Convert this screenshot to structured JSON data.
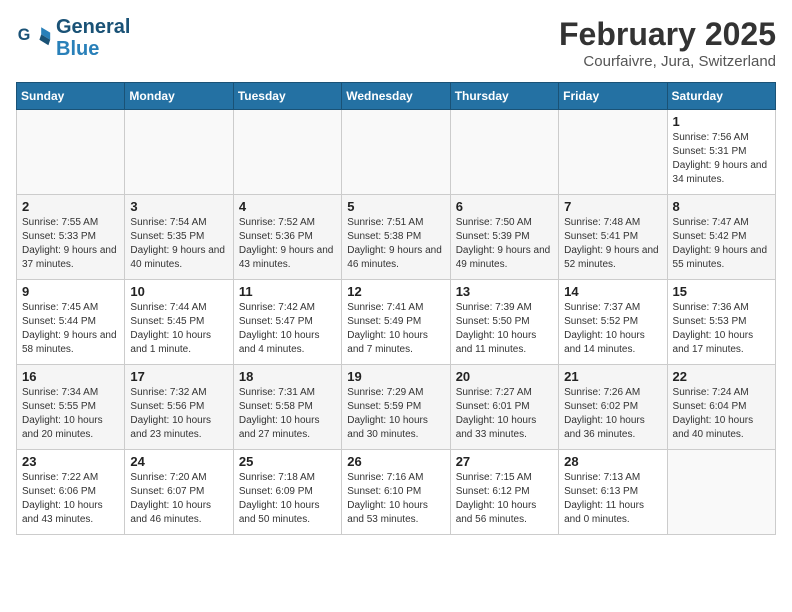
{
  "header": {
    "logo_general": "General",
    "logo_blue": "Blue",
    "month_title": "February 2025",
    "subtitle": "Courfaivre, Jura, Switzerland"
  },
  "calendar": {
    "days_of_week": [
      "Sunday",
      "Monday",
      "Tuesday",
      "Wednesday",
      "Thursday",
      "Friday",
      "Saturday"
    ],
    "weeks": [
      [
        {
          "day": "",
          "info": ""
        },
        {
          "day": "",
          "info": ""
        },
        {
          "day": "",
          "info": ""
        },
        {
          "day": "",
          "info": ""
        },
        {
          "day": "",
          "info": ""
        },
        {
          "day": "",
          "info": ""
        },
        {
          "day": "1",
          "info": "Sunrise: 7:56 AM\nSunset: 5:31 PM\nDaylight: 9 hours and 34 minutes."
        }
      ],
      [
        {
          "day": "2",
          "info": "Sunrise: 7:55 AM\nSunset: 5:33 PM\nDaylight: 9 hours and 37 minutes."
        },
        {
          "day": "3",
          "info": "Sunrise: 7:54 AM\nSunset: 5:35 PM\nDaylight: 9 hours and 40 minutes."
        },
        {
          "day": "4",
          "info": "Sunrise: 7:52 AM\nSunset: 5:36 PM\nDaylight: 9 hours and 43 minutes."
        },
        {
          "day": "5",
          "info": "Sunrise: 7:51 AM\nSunset: 5:38 PM\nDaylight: 9 hours and 46 minutes."
        },
        {
          "day": "6",
          "info": "Sunrise: 7:50 AM\nSunset: 5:39 PM\nDaylight: 9 hours and 49 minutes."
        },
        {
          "day": "7",
          "info": "Sunrise: 7:48 AM\nSunset: 5:41 PM\nDaylight: 9 hours and 52 minutes."
        },
        {
          "day": "8",
          "info": "Sunrise: 7:47 AM\nSunset: 5:42 PM\nDaylight: 9 hours and 55 minutes."
        }
      ],
      [
        {
          "day": "9",
          "info": "Sunrise: 7:45 AM\nSunset: 5:44 PM\nDaylight: 9 hours and 58 minutes."
        },
        {
          "day": "10",
          "info": "Sunrise: 7:44 AM\nSunset: 5:45 PM\nDaylight: 10 hours and 1 minute."
        },
        {
          "day": "11",
          "info": "Sunrise: 7:42 AM\nSunset: 5:47 PM\nDaylight: 10 hours and 4 minutes."
        },
        {
          "day": "12",
          "info": "Sunrise: 7:41 AM\nSunset: 5:49 PM\nDaylight: 10 hours and 7 minutes."
        },
        {
          "day": "13",
          "info": "Sunrise: 7:39 AM\nSunset: 5:50 PM\nDaylight: 10 hours and 11 minutes."
        },
        {
          "day": "14",
          "info": "Sunrise: 7:37 AM\nSunset: 5:52 PM\nDaylight: 10 hours and 14 minutes."
        },
        {
          "day": "15",
          "info": "Sunrise: 7:36 AM\nSunset: 5:53 PM\nDaylight: 10 hours and 17 minutes."
        }
      ],
      [
        {
          "day": "16",
          "info": "Sunrise: 7:34 AM\nSunset: 5:55 PM\nDaylight: 10 hours and 20 minutes."
        },
        {
          "day": "17",
          "info": "Sunrise: 7:32 AM\nSunset: 5:56 PM\nDaylight: 10 hours and 23 minutes."
        },
        {
          "day": "18",
          "info": "Sunrise: 7:31 AM\nSunset: 5:58 PM\nDaylight: 10 hours and 27 minutes."
        },
        {
          "day": "19",
          "info": "Sunrise: 7:29 AM\nSunset: 5:59 PM\nDaylight: 10 hours and 30 minutes."
        },
        {
          "day": "20",
          "info": "Sunrise: 7:27 AM\nSunset: 6:01 PM\nDaylight: 10 hours and 33 minutes."
        },
        {
          "day": "21",
          "info": "Sunrise: 7:26 AM\nSunset: 6:02 PM\nDaylight: 10 hours and 36 minutes."
        },
        {
          "day": "22",
          "info": "Sunrise: 7:24 AM\nSunset: 6:04 PM\nDaylight: 10 hours and 40 minutes."
        }
      ],
      [
        {
          "day": "23",
          "info": "Sunrise: 7:22 AM\nSunset: 6:06 PM\nDaylight: 10 hours and 43 minutes."
        },
        {
          "day": "24",
          "info": "Sunrise: 7:20 AM\nSunset: 6:07 PM\nDaylight: 10 hours and 46 minutes."
        },
        {
          "day": "25",
          "info": "Sunrise: 7:18 AM\nSunset: 6:09 PM\nDaylight: 10 hours and 50 minutes."
        },
        {
          "day": "26",
          "info": "Sunrise: 7:16 AM\nSunset: 6:10 PM\nDaylight: 10 hours and 53 minutes."
        },
        {
          "day": "27",
          "info": "Sunrise: 7:15 AM\nSunset: 6:12 PM\nDaylight: 10 hours and 56 minutes."
        },
        {
          "day": "28",
          "info": "Sunrise: 7:13 AM\nSunset: 6:13 PM\nDaylight: 11 hours and 0 minutes."
        },
        {
          "day": "",
          "info": ""
        }
      ]
    ]
  }
}
